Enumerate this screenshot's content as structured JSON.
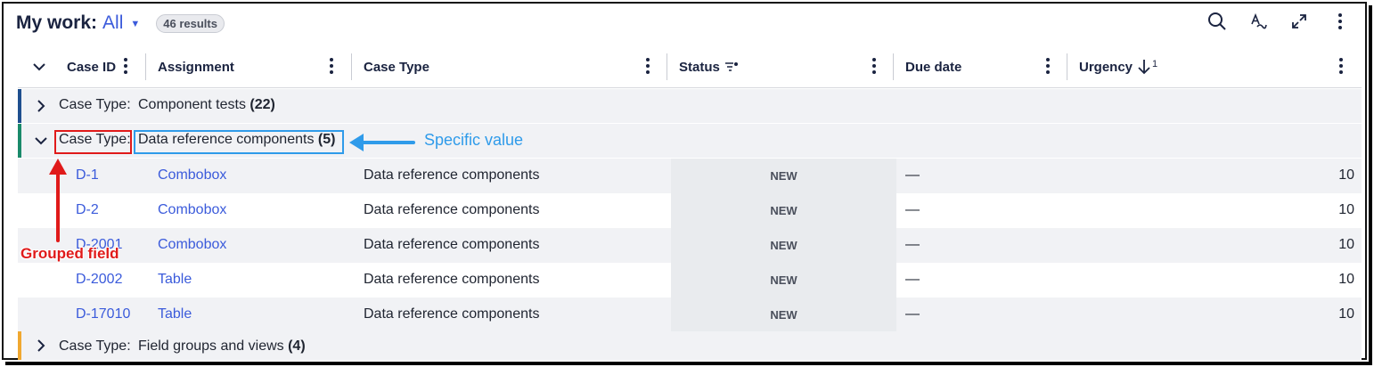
{
  "header": {
    "title": "My work:",
    "view": "All",
    "results": "46 results"
  },
  "toolbar_icons": [
    "search-icon",
    "format-text-icon",
    "expand-icon",
    "more-options-icon"
  ],
  "columns": [
    {
      "label": "Case ID"
    },
    {
      "label": "Assignment"
    },
    {
      "label": "Case Type"
    },
    {
      "label": "Status"
    },
    {
      "label": "Due date"
    },
    {
      "label": "Urgency",
      "sort_order": "1"
    }
  ],
  "groups": [
    {
      "label": "Case Type:",
      "value": "Component tests",
      "count": "(22)",
      "color": "#1f4f8f"
    },
    {
      "label": "Case Type:",
      "value": "Data reference components",
      "count": "(5)",
      "color": "#1a8a6a"
    },
    {
      "label": "Case Type:",
      "value": "Field groups and views",
      "count": "(4)",
      "color": "#f0a830"
    }
  ],
  "rows": [
    {
      "id": "D-1",
      "assignment": "Combobox",
      "case_type": "Data reference components",
      "status": "NEW",
      "due": "—",
      "urgency": "10"
    },
    {
      "id": "D-2",
      "assignment": "Combobox",
      "case_type": "Data reference components",
      "status": "NEW",
      "due": "—",
      "urgency": "10"
    },
    {
      "id": "D-2001",
      "assignment": "Combobox",
      "case_type": "Data reference components",
      "status": "NEW",
      "due": "—",
      "urgency": "10"
    },
    {
      "id": "D-2002",
      "assignment": "Table",
      "case_type": "Data reference components",
      "status": "NEW",
      "due": "—",
      "urgency": "10"
    },
    {
      "id": "D-17010",
      "assignment": "Table",
      "case_type": "Data reference components",
      "status": "NEW",
      "due": "—",
      "urgency": "10"
    }
  ],
  "annotations": {
    "specific_value": "Specific value",
    "grouped_field": "Grouped field"
  },
  "colors": {
    "accent": "#3b5bdb",
    "annotation_red": "#e01a1a",
    "annotation_blue": "#2f9bea"
  }
}
